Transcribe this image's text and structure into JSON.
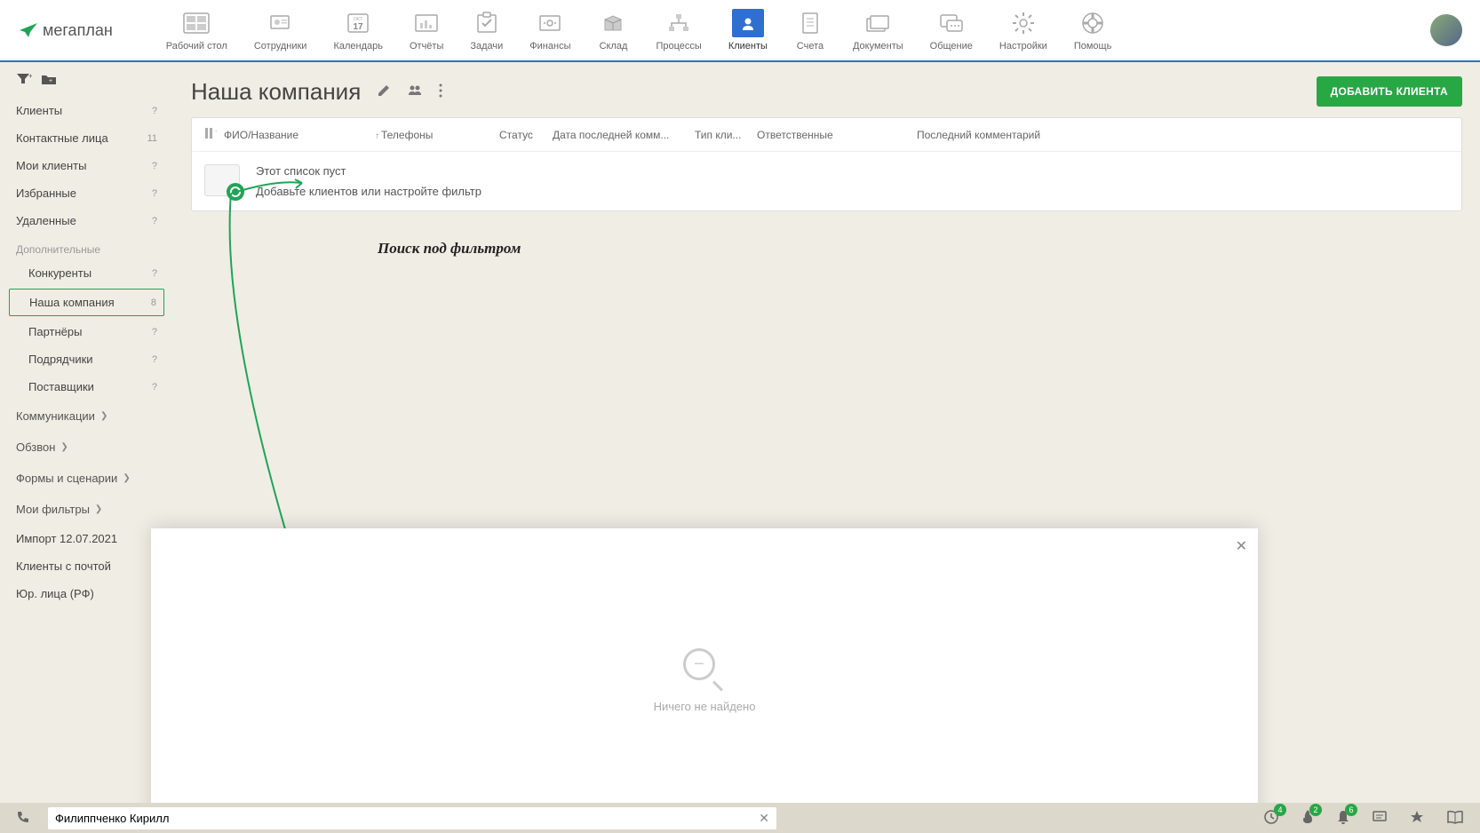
{
  "logo_text": "мегаплан",
  "nav": [
    {
      "label": "Рабочий стол"
    },
    {
      "label": "Сотрудники"
    },
    {
      "label": "Календарь"
    },
    {
      "label": "Отчёты"
    },
    {
      "label": "Задачи"
    },
    {
      "label": "Финансы"
    },
    {
      "label": "Склад"
    },
    {
      "label": "Процессы"
    },
    {
      "label": "Клиенты"
    },
    {
      "label": "Счета"
    },
    {
      "label": "Документы"
    },
    {
      "label": "Общение"
    },
    {
      "label": "Настройки"
    },
    {
      "label": "Помощь"
    }
  ],
  "calendar_badge": "17",
  "calendar_month": "ОКТ",
  "sidebar": {
    "main": [
      {
        "label": "Клиенты",
        "count": "?"
      },
      {
        "label": "Контактные лица",
        "count": "11"
      },
      {
        "label": "Мои клиенты",
        "count": "?"
      },
      {
        "label": "Избранные",
        "count": "?"
      },
      {
        "label": "Удаленные",
        "count": "?"
      }
    ],
    "additional_header": "Дополнительные",
    "additional": [
      {
        "label": "Конкуренты",
        "count": "?"
      },
      {
        "label": "Наша компания",
        "count": "8"
      },
      {
        "label": "Партнёры",
        "count": "?"
      },
      {
        "label": "Подрядчики",
        "count": "?"
      },
      {
        "label": "Поставщики",
        "count": "?"
      }
    ],
    "sections": [
      {
        "label": "Коммуникации"
      },
      {
        "label": "Обзвон"
      },
      {
        "label": "Формы и сценарии"
      },
      {
        "label": "Мои фильтры"
      }
    ],
    "bottom": [
      {
        "label": "Импорт 12.07.2021"
      },
      {
        "label": "Клиенты с почтой"
      },
      {
        "label": "Юр. лица (РФ)"
      }
    ]
  },
  "page": {
    "title": "Наша компания",
    "add_button": "ДОБАВИТЬ КЛИЕНТА"
  },
  "table": {
    "columns": {
      "name": "ФИО/Название",
      "phone": "Телефоны",
      "status": "Статус",
      "lastcomm": "Дата последней комм...",
      "type": "Тип кли...",
      "resp": "Ответственные",
      "comment": "Последний комментарий"
    },
    "empty_title": "Этот список пуст",
    "empty_sub": "Добавьте клиентов или настройте фильтр"
  },
  "annotation": "Поиск под фильтром",
  "popup": {
    "no_results": "Ничего не найдено"
  },
  "search": {
    "value": "Филиппченко Кирилл"
  },
  "badges": {
    "alert": "4",
    "fire": "2",
    "bell": "6"
  }
}
